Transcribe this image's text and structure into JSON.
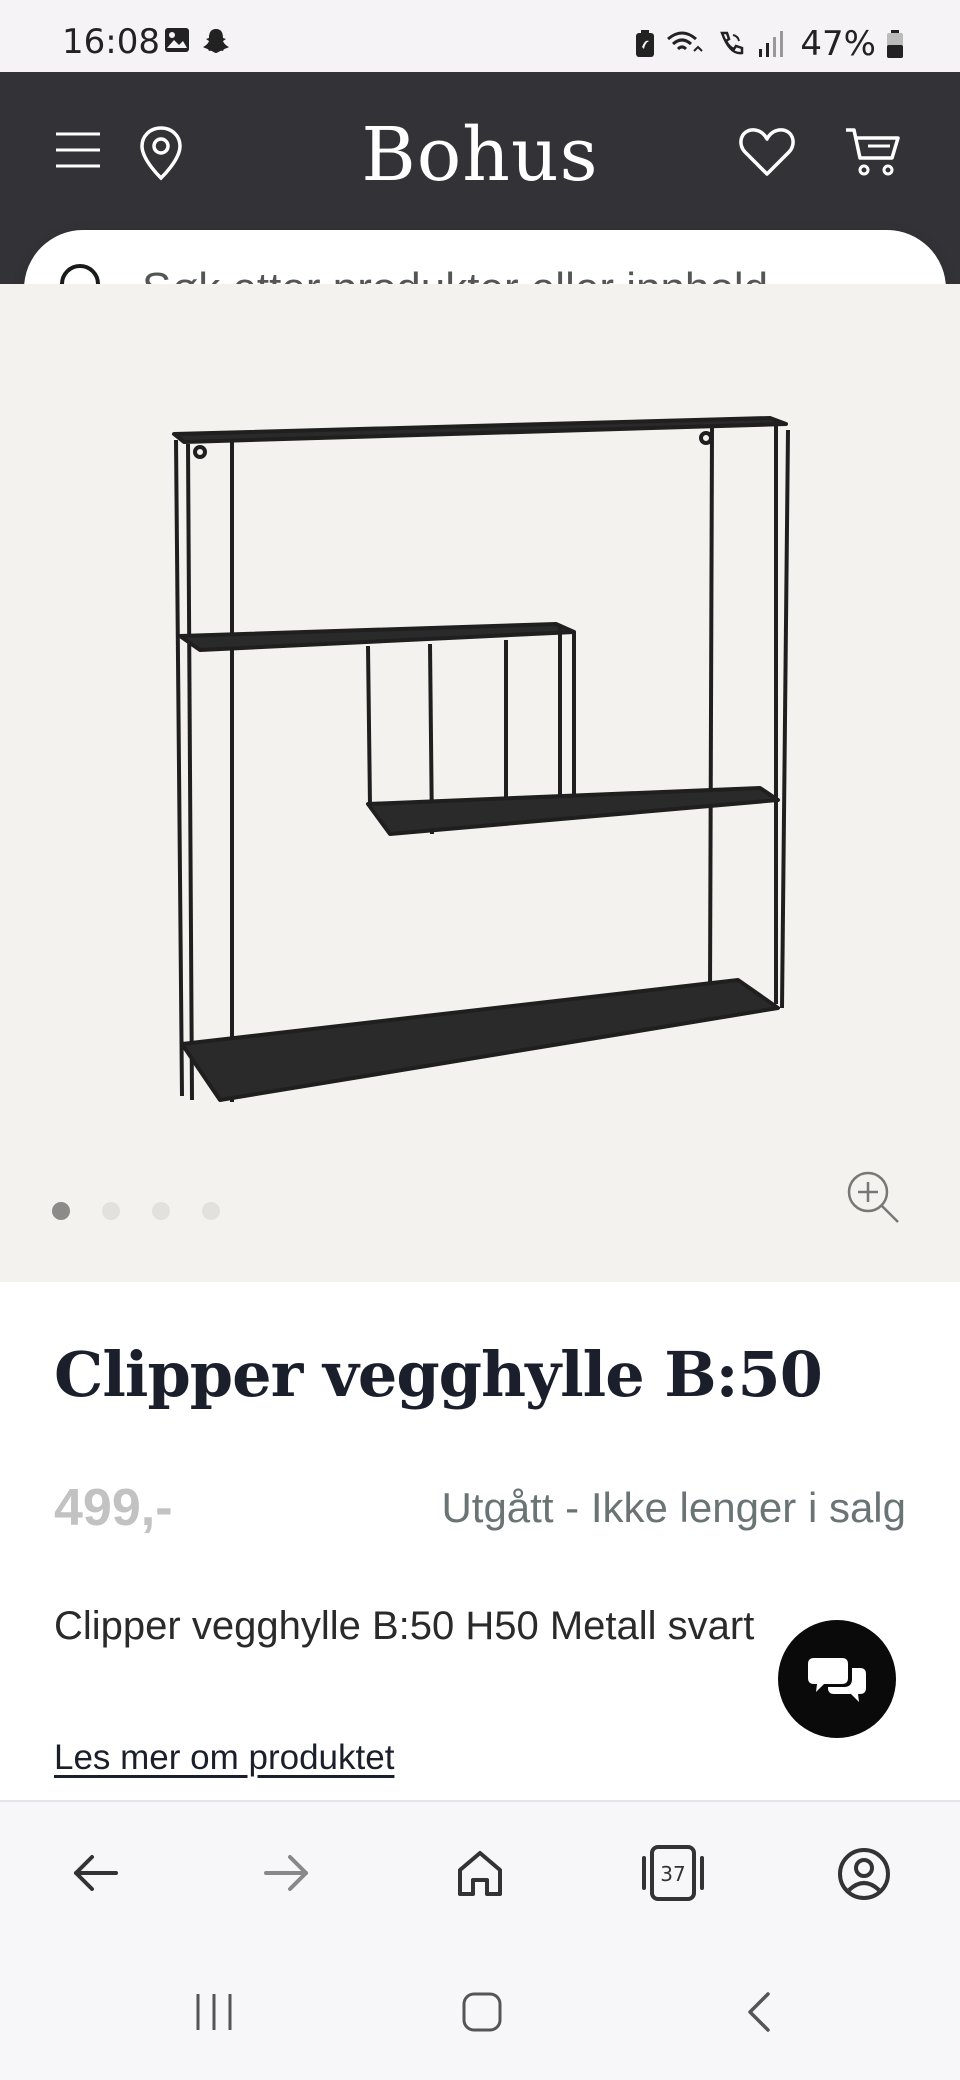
{
  "status_bar": {
    "time": "16:08",
    "battery": "47%",
    "icons_left": [
      "image-icon",
      "snapchat-icon"
    ],
    "icons_right": [
      "battery-saver-icon",
      "wifi-call-icon",
      "phone-call-icon",
      "signal-icon",
      "battery-icon"
    ]
  },
  "header": {
    "logo": "Bohus",
    "icons": [
      "menu-icon",
      "location-pin-icon",
      "heart-icon",
      "cart-icon"
    ],
    "background": "#333236"
  },
  "search": {
    "placeholder": "Søk etter produkter eller innhold..."
  },
  "gallery": {
    "image_count": 4,
    "active_index": 0,
    "background": "#f4f2ef"
  },
  "product": {
    "title": "Clipper vegghylle B:50",
    "price": "499,-",
    "availability": "Utgått - Ikke lenger i salg",
    "description": "Clipper vegghylle B:50 H50 Metall svart",
    "read_more": "Les mer om produktet"
  },
  "browser_bar": {
    "tab_count": "37",
    "icons": [
      "back-arrow-icon",
      "forward-arrow-icon",
      "home-icon",
      "tabs-icon",
      "account-icon"
    ]
  },
  "system_nav": {
    "icons": [
      "recent-apps-icon",
      "home-button-icon",
      "back-button-icon"
    ]
  }
}
